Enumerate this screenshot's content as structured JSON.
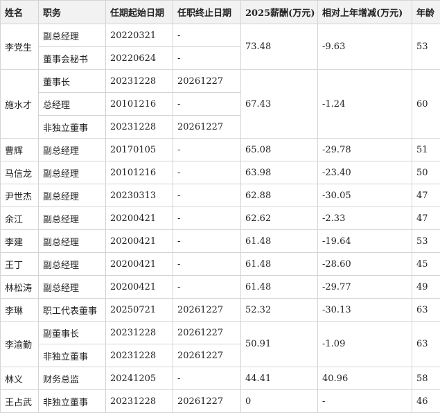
{
  "header": {
    "name": "姓名",
    "position": "职务",
    "start": "任期起始日期",
    "end": "任职终止日期",
    "salary": "2025薪酬(万元)",
    "change": "相对上年增减(万元)",
    "age": "年龄"
  },
  "people": [
    {
      "name": "李党生",
      "salary": "73.48",
      "change": "-9.63",
      "age": "53",
      "roles": [
        {
          "position": "副总经理",
          "start": "20220321",
          "end": "-"
        },
        {
          "position": "董事会秘书",
          "start": "20220624",
          "end": "-"
        }
      ]
    },
    {
      "name": "施水才",
      "salary": "67.43",
      "change": "-1.24",
      "age": "60",
      "roles": [
        {
          "position": "董事长",
          "start": "20231228",
          "end": "20261227"
        },
        {
          "position": "总经理",
          "start": "20101216",
          "end": "-"
        },
        {
          "position": "非独立董事",
          "start": "20231228",
          "end": "20261227"
        }
      ]
    },
    {
      "name": "曹辉",
      "salary": "65.08",
      "change": "-29.78",
      "age": "51",
      "roles": [
        {
          "position": "副总经理",
          "start": "20170105",
          "end": "-"
        }
      ]
    },
    {
      "name": "马信龙",
      "salary": "63.98",
      "change": "-23.40",
      "age": "50",
      "roles": [
        {
          "position": "副总经理",
          "start": "20101216",
          "end": "-"
        }
      ]
    },
    {
      "name": "尹世杰",
      "salary": "62.88",
      "change": "-30.05",
      "age": "47",
      "roles": [
        {
          "position": "副总经理",
          "start": "20230313",
          "end": "-"
        }
      ]
    },
    {
      "name": "余江",
      "salary": "62.62",
      "change": "-2.33",
      "age": "47",
      "roles": [
        {
          "position": "副总经理",
          "start": "20200421",
          "end": "-"
        }
      ]
    },
    {
      "name": "李建",
      "salary": "61.48",
      "change": "-19.64",
      "age": "53",
      "roles": [
        {
          "position": "副总经理",
          "start": "20200421",
          "end": "-"
        }
      ]
    },
    {
      "name": "王丁",
      "salary": "61.48",
      "change": "-28.60",
      "age": "45",
      "roles": [
        {
          "position": "副总经理",
          "start": "20200421",
          "end": "-"
        }
      ]
    },
    {
      "name": "林松涛",
      "salary": "61.48",
      "change": "-29.77",
      "age": "49",
      "roles": [
        {
          "position": "副总经理",
          "start": "20200421",
          "end": "-"
        }
      ]
    },
    {
      "name": "李琳",
      "salary": "52.32",
      "change": "-30.13",
      "age": "63",
      "roles": [
        {
          "position": "职工代表董事",
          "start": "20250721",
          "end": "20261227"
        }
      ]
    },
    {
      "name": "李渝勤",
      "salary": "50.91",
      "change": "-1.09",
      "age": "63",
      "roles": [
        {
          "position": "副董事长",
          "start": "20231228",
          "end": "20261227"
        },
        {
          "position": "非独立董事",
          "start": "20231228",
          "end": "20261227"
        }
      ]
    },
    {
      "name": "林义",
      "salary": "44.41",
      "change": "40.96",
      "age": "58",
      "roles": [
        {
          "position": "财务总监",
          "start": "20241205",
          "end": "-"
        }
      ]
    },
    {
      "name": "王占武",
      "salary": "0",
      "change": "-",
      "age": "46",
      "roles": [
        {
          "position": "非独立董事",
          "start": "20231228",
          "end": "20261227"
        }
      ]
    }
  ]
}
